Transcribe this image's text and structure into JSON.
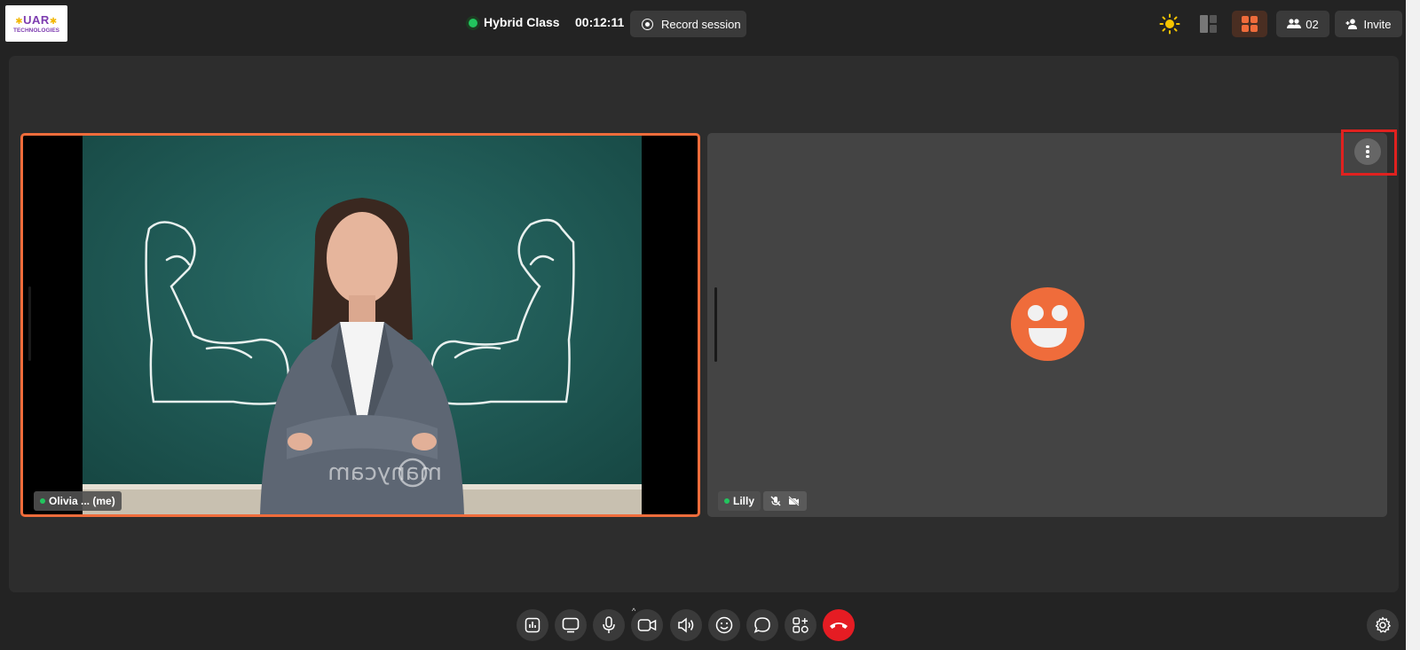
{
  "header": {
    "logo_line1": "UAR",
    "logo_line2": "TECHNOLOGIES",
    "class_title": "Hybrid Class",
    "timer": "00:12:11",
    "record_label": "Record session",
    "participants_count": "02",
    "invite_label": "Invite"
  },
  "tiles": [
    {
      "name": "Olivia ... (me)",
      "status": "online",
      "has_video": true
    },
    {
      "name": "Lilly",
      "status": "online",
      "has_video": false,
      "muted": true,
      "camera_off": true
    }
  ],
  "controls": [
    "poll-icon",
    "screen-share-icon",
    "microphone-icon",
    "camera-icon",
    "speaker-icon",
    "emoji-icon",
    "chat-icon",
    "apps-icon",
    "end-call-icon",
    "settings-icon"
  ],
  "colors": {
    "accent": "#ef6c3b",
    "online": "#22c55e",
    "end_call": "#e51c23",
    "highlight": "#e0211f",
    "sun": "#f5c400"
  }
}
